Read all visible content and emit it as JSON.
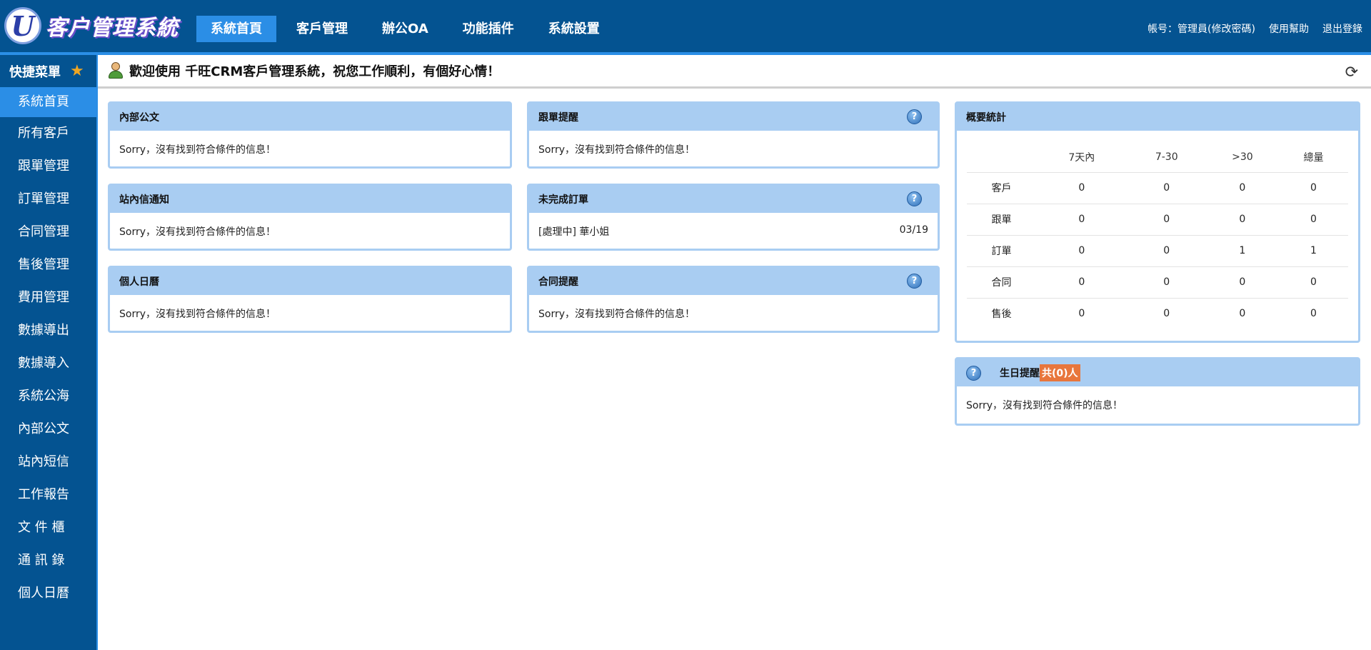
{
  "header": {
    "logo_text": "客户管理系統",
    "nav": [
      "系統首頁",
      "客戶管理",
      "辦公OA",
      "功能插件",
      "系統設置"
    ],
    "account": "帳号：管理員(修改密碼)",
    "help": "使用幫助",
    "logout": "退出登錄"
  },
  "sidebar": {
    "title": "快捷菜單",
    "items": [
      "系統首頁",
      "所有客戶",
      "跟單管理",
      "訂單管理",
      "合同管理",
      "售後管理",
      "費用管理",
      "數據導出",
      "數據導入",
      "系統公海",
      "內部公文",
      "站內短信",
      "工作報告",
      "文 件 櫃",
      "通 訊 錄",
      "個人日曆"
    ]
  },
  "welcome": {
    "text": "歡迎使用 千旺CRM客戶管理系統，祝您工作順利，有個好心情！"
  },
  "panels": {
    "internal_doc": {
      "title": "內部公文",
      "body": "Sorry，沒有找到符合條件的信息！"
    },
    "follow_reminder": {
      "title": "跟單提醒",
      "body": "Sorry，沒有找到符合條件的信息！"
    },
    "site_notice": {
      "title": "站內信通知",
      "body": "Sorry，沒有找到符合條件的信息！"
    },
    "pending_orders": {
      "title": "未完成訂單",
      "item": "[處理中] 華小姐",
      "date": "03/19"
    },
    "calendar": {
      "title": "個人日曆",
      "body": "Sorry，沒有找到符合條件的信息！"
    },
    "contract_reminder": {
      "title": "合同提醒",
      "body": "Sorry，沒有找到符合條件的信息！"
    },
    "stats": {
      "title": "概要統計",
      "columns": [
        "",
        "7天內",
        "7-30",
        ">30",
        "總量"
      ],
      "rows": [
        [
          "客戶",
          "0",
          "0",
          "0",
          "0"
        ],
        [
          "跟單",
          "0",
          "0",
          "0",
          "0"
        ],
        [
          "訂單",
          "0",
          "0",
          "1",
          "1"
        ],
        [
          "合同",
          "0",
          "0",
          "0",
          "0"
        ],
        [
          "售後",
          "0",
          "0",
          "0",
          "0"
        ]
      ]
    },
    "birthday": {
      "title": "生日提醒",
      "count": "共(0)人",
      "body": "Sorry，沒有找到符合條件的信息！"
    }
  },
  "icons": {
    "help": "question-icon",
    "refresh": "refresh-icon",
    "star": "star-icon",
    "user": "user-icon"
  },
  "colors": {
    "primary": "#045391",
    "accent": "#2b8ee6",
    "panel_header": "#a9cdf2",
    "badge": "#e8763c"
  }
}
